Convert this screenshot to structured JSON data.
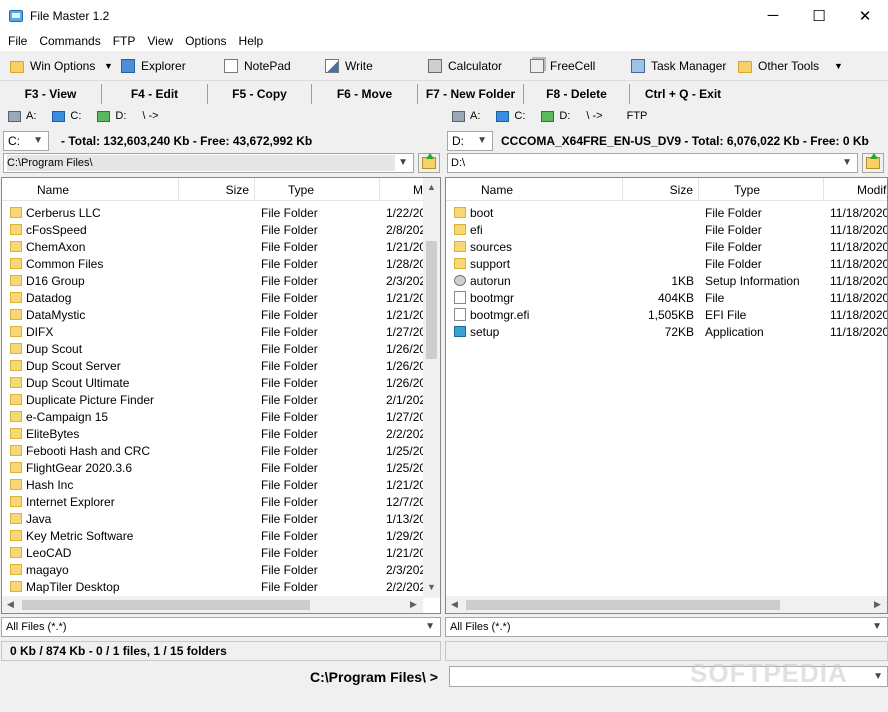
{
  "window": {
    "title": "File Master 1.2",
    "minimize": "─",
    "maximize": "☐",
    "close": "✕"
  },
  "menu": [
    "File",
    "Commands",
    "FTP",
    "View",
    "Options",
    "Help"
  ],
  "toolbar": {
    "win_options": "Win Options",
    "explorer": "Explorer",
    "notepad": "NotePad",
    "write": "Write",
    "calculator": "Calculator",
    "freecell": "FreeCell",
    "task_manager": "Task Manager",
    "other_tools": "Other Tools"
  },
  "fkeys": [
    "F3 - View",
    "F4 - Edit",
    "F5 - Copy",
    "F6 - Move",
    "F7 - New Folder",
    "F8 - Delete",
    "Ctrl + Q - Exit"
  ],
  "left": {
    "drives": [
      "A:",
      "C:",
      "D:",
      "\\ ->"
    ],
    "drive": "C:",
    "info": "- Total: 132,603,240 Kb - Free: 43,672,992 Kb",
    "path": "C:\\Program Files\\",
    "columns": [
      "Name",
      "Size",
      "Type",
      "Mo"
    ],
    "rows": [
      {
        "name": "Cerberus LLC",
        "size": "",
        "type": "File Folder",
        "date": "1/22/20"
      },
      {
        "name": "cFosSpeed",
        "size": "",
        "type": "File Folder",
        "date": "2/8/202"
      },
      {
        "name": "ChemAxon",
        "size": "",
        "type": "File Folder",
        "date": "1/21/20"
      },
      {
        "name": "Common Files",
        "size": "",
        "type": "File Folder",
        "date": "1/28/20"
      },
      {
        "name": "D16 Group",
        "size": "",
        "type": "File Folder",
        "date": "2/3/202"
      },
      {
        "name": "Datadog",
        "size": "",
        "type": "File Folder",
        "date": "1/21/20"
      },
      {
        "name": "DataMystic",
        "size": "",
        "type": "File Folder",
        "date": "1/21/20"
      },
      {
        "name": "DIFX",
        "size": "",
        "type": "File Folder",
        "date": "1/27/20"
      },
      {
        "name": "Dup Scout",
        "size": "",
        "type": "File Folder",
        "date": "1/26/20"
      },
      {
        "name": "Dup Scout Server",
        "size": "",
        "type": "File Folder",
        "date": "1/26/20"
      },
      {
        "name": "Dup Scout Ultimate",
        "size": "",
        "type": "File Folder",
        "date": "1/26/20"
      },
      {
        "name": "Duplicate Picture Finder",
        "size": "",
        "type": "File Folder",
        "date": "2/1/202"
      },
      {
        "name": "e-Campaign 15",
        "size": "",
        "type": "File Folder",
        "date": "1/27/20"
      },
      {
        "name": "EliteBytes",
        "size": "",
        "type": "File Folder",
        "date": "2/2/202"
      },
      {
        "name": "Febooti Hash and CRC",
        "size": "",
        "type": "File Folder",
        "date": "1/25/20"
      },
      {
        "name": "FlightGear 2020.3.6",
        "size": "",
        "type": "File Folder",
        "date": "1/25/20"
      },
      {
        "name": "Hash Inc",
        "size": "",
        "type": "File Folder",
        "date": "1/21/20"
      },
      {
        "name": "Internet Explorer",
        "size": "",
        "type": "File Folder",
        "date": "12/7/20"
      },
      {
        "name": "Java",
        "size": "",
        "type": "File Folder",
        "date": "1/13/20"
      },
      {
        "name": "Key Metric Software",
        "size": "",
        "type": "File Folder",
        "date": "1/29/20"
      },
      {
        "name": "LeoCAD",
        "size": "",
        "type": "File Folder",
        "date": "1/21/20"
      },
      {
        "name": "magayo",
        "size": "",
        "type": "File Folder",
        "date": "2/3/202"
      },
      {
        "name": "MapTiler Desktop",
        "size": "",
        "type": "File Folder",
        "date": "2/2/202"
      }
    ],
    "filter": "All Files (*.*)"
  },
  "right": {
    "drives": [
      "A:",
      "C:",
      "D:",
      "\\ ->",
      "FTP"
    ],
    "drive": "D:",
    "info": "CCCOMA_X64FRE_EN-US_DV9 - Total: 6,076,022 Kb - Free: 0 Kb",
    "path": "D:\\",
    "columns": [
      "Name",
      "Size",
      "Type",
      "Modifi"
    ],
    "rows": [
      {
        "name": "boot",
        "size": "",
        "type": "File Folder",
        "date": "11/18/2020",
        "icon": "folder"
      },
      {
        "name": "efi",
        "size": "",
        "type": "File Folder",
        "date": "11/18/2020",
        "icon": "folder"
      },
      {
        "name": "sources",
        "size": "",
        "type": "File Folder",
        "date": "11/18/2020",
        "icon": "folder"
      },
      {
        "name": "support",
        "size": "",
        "type": "File Folder",
        "date": "11/18/2020",
        "icon": "folder"
      },
      {
        "name": "autorun",
        "size": "1KB",
        "type": "Setup Information",
        "date": "11/18/2020",
        "icon": "gear"
      },
      {
        "name": "bootmgr",
        "size": "404KB",
        "type": "File",
        "date": "11/18/2020",
        "icon": "file"
      },
      {
        "name": "bootmgr.efi",
        "size": "1,505KB",
        "type": "EFI File",
        "date": "11/18/2020",
        "icon": "file"
      },
      {
        "name": "setup",
        "size": "72KB",
        "type": "Application",
        "date": "11/18/2020",
        "icon": "app"
      }
    ],
    "filter": "All Files (*.*)"
  },
  "status": "0 Kb / 874 Kb - 0 / 1 files, 1 / 15 folders",
  "command": {
    "label": "C:\\Program Files\\ >",
    "value": ""
  },
  "watermark": "SOFTPEDIA"
}
